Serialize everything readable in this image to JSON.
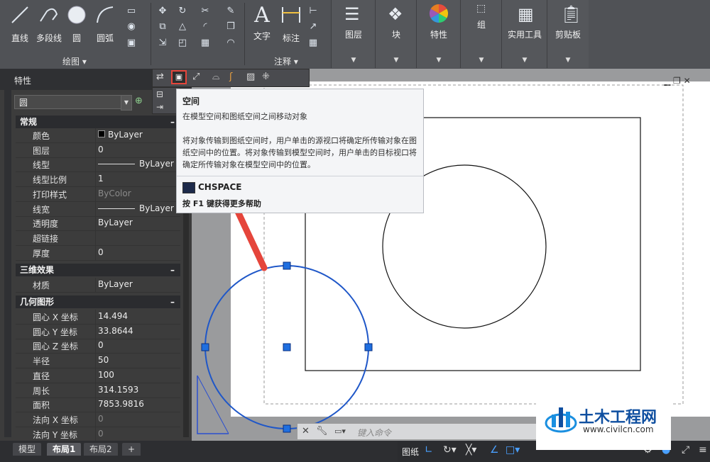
{
  "ribbon": {
    "draw": {
      "line": "直线",
      "polyline": "多段线",
      "circle": "圆",
      "arc": "圆弧",
      "panel_title": "绘图 ▾"
    },
    "annotation": {
      "text": "文字",
      "dimension": "标注",
      "panel_title": "注释 ▾"
    },
    "panels": {
      "layers": "图层",
      "block": "块",
      "properties": "特性",
      "groups": "组",
      "utilities": "实用工具",
      "clipboard": "剪贴板"
    }
  },
  "properties_palette": {
    "title": "特性",
    "object_type": "圆",
    "sections": {
      "general": "常规",
      "threed": "三维效果",
      "geometry": "几何图形"
    },
    "general_rows": [
      {
        "key": "颜色",
        "value": "ByLayer"
      },
      {
        "key": "图层",
        "value": "0"
      },
      {
        "key": "线型",
        "value": "ByLayer"
      },
      {
        "key": "线型比例",
        "value": "1"
      },
      {
        "key": "打印样式",
        "value": "ByColor"
      },
      {
        "key": "线宽",
        "value": "ByLayer"
      },
      {
        "key": "透明度",
        "value": "ByLayer"
      },
      {
        "key": "超链接",
        "value": ""
      },
      {
        "key": "厚度",
        "value": "0"
      }
    ],
    "threed_rows": [
      {
        "key": "材质",
        "value": "ByLayer"
      }
    ],
    "geometry_rows": [
      {
        "key": "圆心 X 坐标",
        "value": "14.494"
      },
      {
        "key": "圆心 Y 坐标",
        "value": "33.8644"
      },
      {
        "key": "圆心 Z 坐标",
        "value": "0"
      },
      {
        "key": "半径",
        "value": "50"
      },
      {
        "key": "直径",
        "value": "100"
      },
      {
        "key": "周长",
        "value": "314.1593"
      },
      {
        "key": "面积",
        "value": "7853.9816"
      },
      {
        "key": "法向 X 坐标",
        "value": "0"
      },
      {
        "key": "法向 Y 坐标",
        "value": "0"
      }
    ]
  },
  "tooltip": {
    "title": "空间",
    "short_desc": "在模型空间和图纸空间之间移动对象",
    "long_desc": "将对象传输到图纸空间时，用户单击的源视口将确定所传输对象在图纸空间中的位置。将对象传输到模型空间时，用户单击的目标视口将确定所传输对象在模型空间中的位置。",
    "command": "CHSPACE",
    "help": "按 F1 键获得更多帮助"
  },
  "command_line": {
    "placeholder": "键入命令"
  },
  "layout_tabs": [
    "模型",
    "布局1",
    "布局2"
  ],
  "status_bar": {
    "paper_label": "图纸"
  },
  "watermark": {
    "name": "土木工程网",
    "url": "www.civilcn.com"
  },
  "colors": {
    "highlight_arrow": "#e5453b",
    "selection_blue": "#1f57c8",
    "tooltip_bg": "#f4f5f7"
  }
}
